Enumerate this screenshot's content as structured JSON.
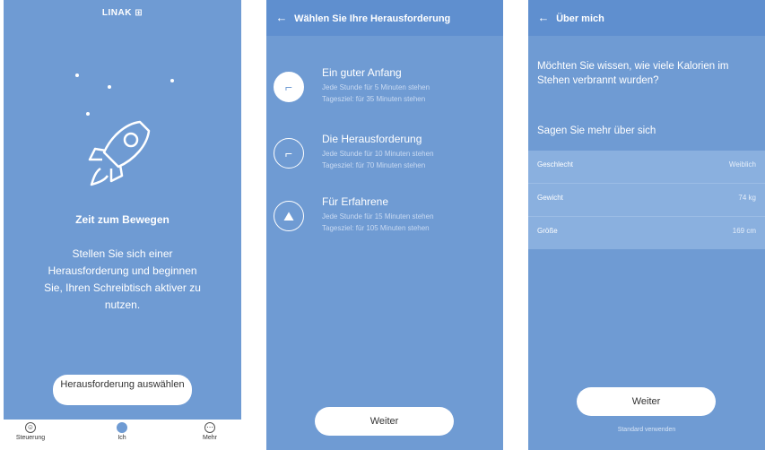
{
  "screen1": {
    "logo": "LINAK ⊞",
    "title": "Zeit zum Bewegen",
    "body": "Stellen Sie sich einer Herausforderung und beginnen Sie, Ihren Schreibtisch aktiver zu nutzen.",
    "button": "Herausforderung auswählen",
    "tabs": [
      {
        "label": "Steuerung",
        "icon": "smiley-icon"
      },
      {
        "label": "Ich",
        "icon": "user-dot-icon"
      },
      {
        "label": "Mehr",
        "icon": "more-icon"
      }
    ]
  },
  "screen2": {
    "header": "Wählen Sie Ihre Herausforderung",
    "options": [
      {
        "title": "Ein guter Anfang",
        "line1": "Jede Stunde für 5 Minuten stehen",
        "line2": "Tagesziel: für 35 Minuten stehen"
      },
      {
        "title": "Die Herausforderung",
        "line1": "Jede Stunde für 10 Minuten stehen",
        "line2": "Tagesziel: für 70 Minuten stehen"
      },
      {
        "title": "Für Erfahrene",
        "line1": "Jede Stunde für 15 Minuten stehen",
        "line2": "Tagesziel: für 105 Minuten stehen"
      }
    ],
    "button": "Weiter"
  },
  "screen3": {
    "header": "Über mich",
    "question": "Möchten Sie wissen, wie viele Kalorien im Stehen verbrannt wurden?",
    "more": "Sagen Sie mehr über sich",
    "rows": [
      {
        "label": "Geschlecht",
        "value": "Weiblich"
      },
      {
        "label": "Gewicht",
        "value": "74 kg"
      },
      {
        "label": "Größe",
        "value": "169 cm"
      }
    ],
    "button": "Weiter",
    "skip": "Standard verwenden"
  },
  "colors": {
    "background": "#6f9bd3",
    "header": "#5f8fcf",
    "button": "#ffffff"
  }
}
